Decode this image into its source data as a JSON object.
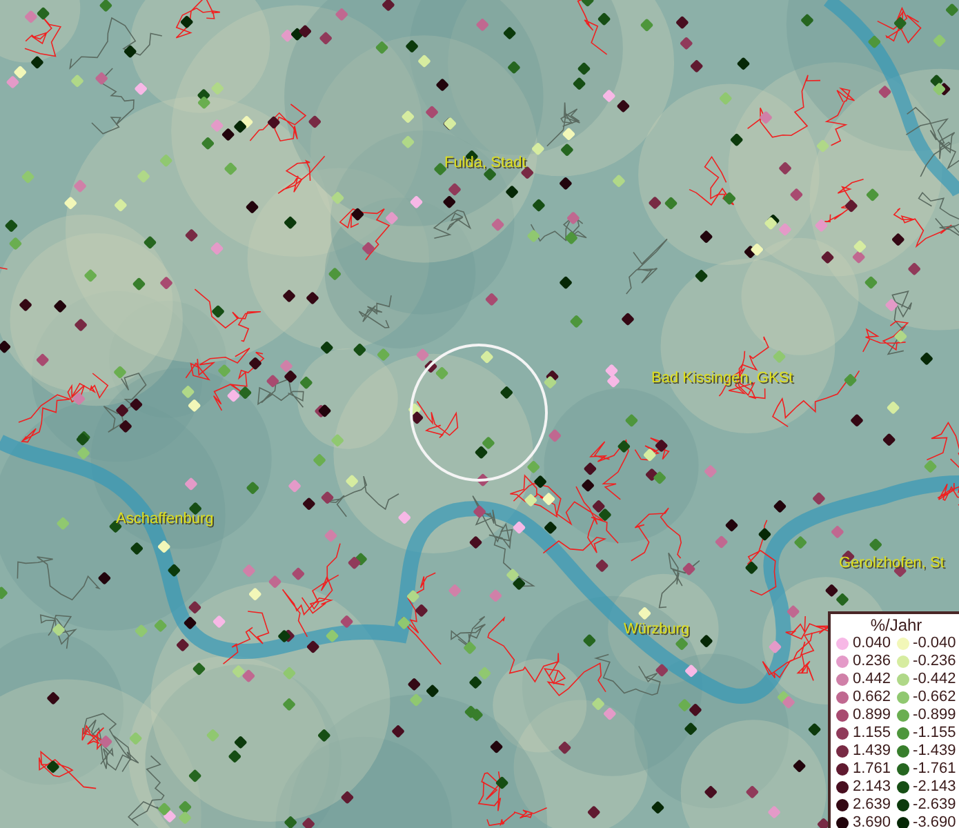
{
  "map": {
    "places": [
      {
        "name": "Fulda, Stadt"
      },
      {
        "name": "Bad Kissingen, GKSt"
      },
      {
        "name": "Aschaffenburg"
      },
      {
        "name": "Würzburg"
      },
      {
        "name": "Gerolzhofen, St"
      }
    ]
  },
  "legend": {
    "title": "%/Jahr",
    "increase": [
      {
        "label": "0.040",
        "color": "#f7b8e6"
      },
      {
        "label": "0.236",
        "color": "#e49ac8"
      },
      {
        "label": "0.442",
        "color": "#d080a8"
      },
      {
        "label": "0.662",
        "color": "#c06890"
      },
      {
        "label": "0.899",
        "color": "#a84a70"
      },
      {
        "label": "1.155",
        "color": "#903a5a"
      },
      {
        "label": "1.439",
        "color": "#782a44"
      },
      {
        "label": "1.761",
        "color": "#601a30"
      },
      {
        "label": "2.143",
        "color": "#480e20"
      },
      {
        "label": "2.639",
        "color": "#340814"
      },
      {
        "label": "3.690",
        "color": "#22040c"
      }
    ],
    "decrease": [
      {
        "label": "-0.040",
        "color": "#f2f7b8"
      },
      {
        "label": "-0.236",
        "color": "#d6eca0"
      },
      {
        "label": "-0.442",
        "color": "#b0d888"
      },
      {
        "label": "-0.662",
        "color": "#90c870"
      },
      {
        "label": "-0.899",
        "color": "#6aae50"
      },
      {
        "label": "-1.155",
        "color": "#4e963c"
      },
      {
        "label": "-1.439",
        "color": "#387e2c"
      },
      {
        "label": "-1.761",
        "color": "#266620"
      },
      {
        "label": "-2.143",
        "color": "#164e14"
      },
      {
        "label": "-2.639",
        "color": "#0c3a0c"
      },
      {
        "label": "-3.690",
        "color": "#062806"
      }
    ]
  }
}
